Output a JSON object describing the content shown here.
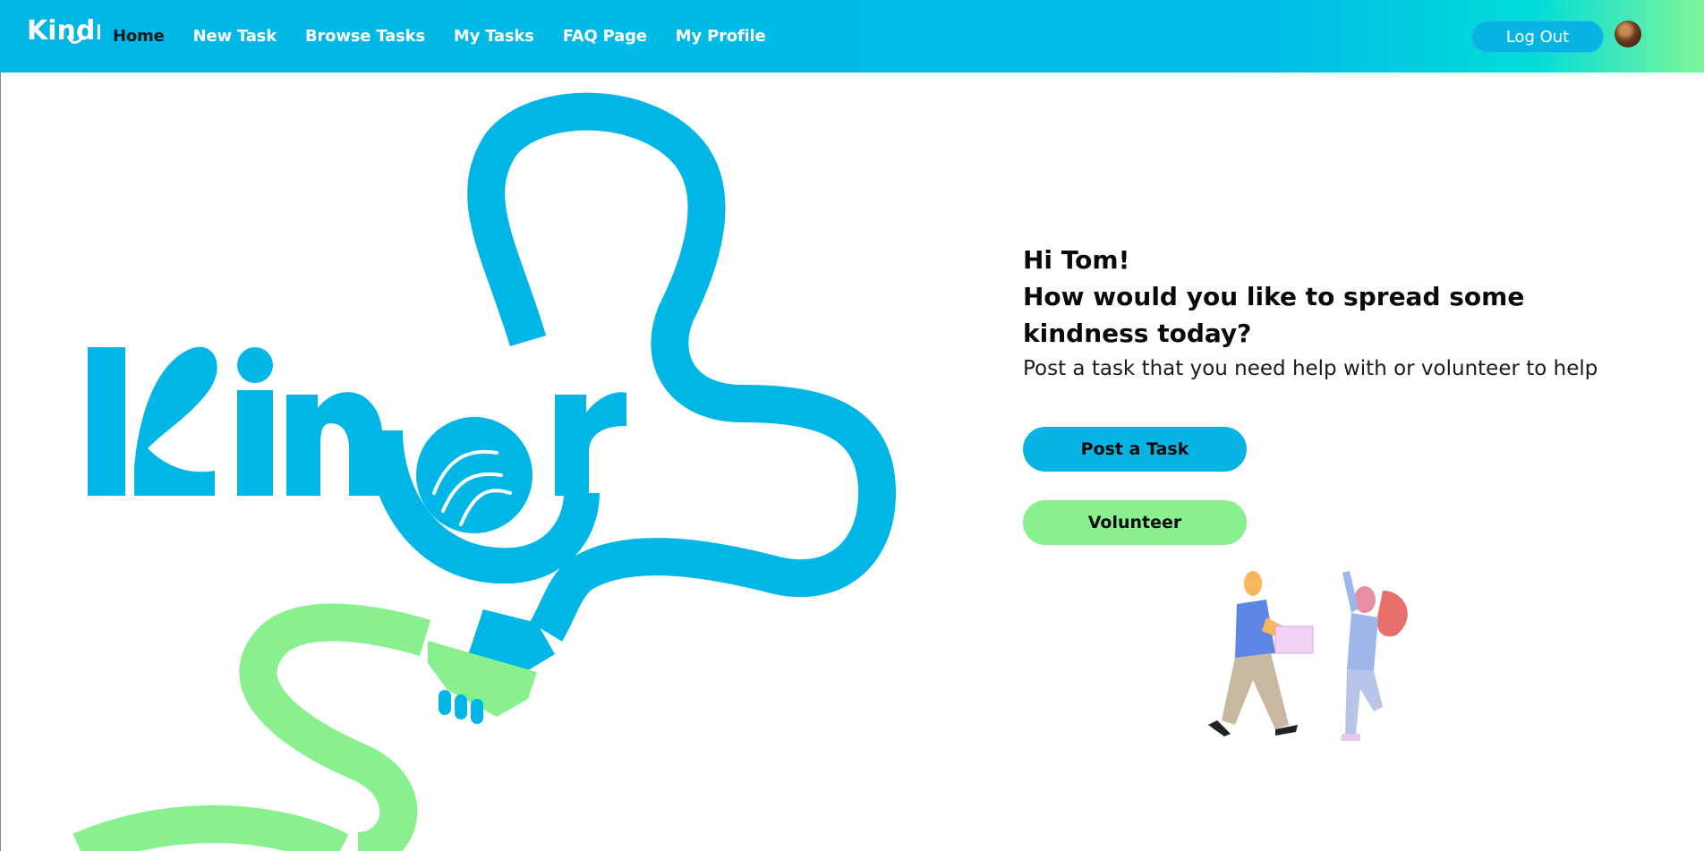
{
  "app": {
    "logo_text": "Kindr"
  },
  "nav": {
    "items": [
      {
        "label": "Home",
        "active": true
      },
      {
        "label": "New Task",
        "active": false
      },
      {
        "label": "Browse Tasks",
        "active": false
      },
      {
        "label": "My Tasks",
        "active": false
      },
      {
        "label": "FAQ Page",
        "active": false
      },
      {
        "label": "My Profile",
        "active": false
      }
    ],
    "logout_label": "Log Out",
    "avatar_icon": "user-avatar"
  },
  "hero": {
    "greeting": "Hi Tom!",
    "question": "How would you like to spread some kindness today?",
    "subtext": "Post a task that you need help with or volunteer to help"
  },
  "actions": {
    "post_label": "Post a Task",
    "volunteer_label": "Volunteer"
  },
  "colors": {
    "brand_blue": "#00b6e6",
    "brand_green": "#88f08e",
    "text_dark": "#0a0a0a"
  }
}
